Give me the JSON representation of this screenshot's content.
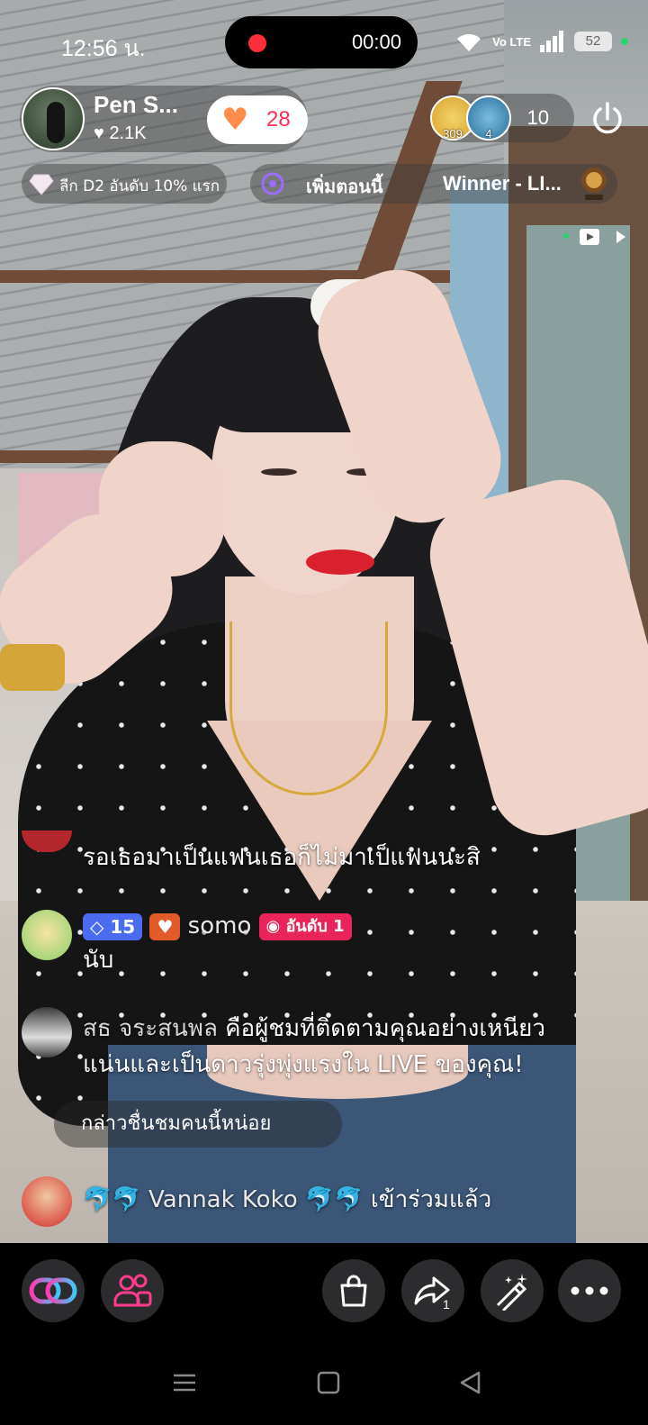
{
  "status_bar": {
    "time": "12:56 น.",
    "recording_time": "00:00",
    "network_label": "Vo LTE",
    "battery": "52"
  },
  "host": {
    "name": "Pen S...",
    "likes": "2.1K",
    "follow_count": "28"
  },
  "viewers": {
    "top1_score": "309",
    "top2_score": "4",
    "count": "10"
  },
  "league_pill": "ลีก D2 อันดับ 10% แรก",
  "goal_pill": {
    "action": "เพิ่มตอนนี้",
    "winner": "Winner - LI..."
  },
  "comments": [
    {
      "text": "รอเธอมาเป็นแฟนเธอก็ไม่มาเป็แฟนนะสิ"
    },
    {
      "level": "15",
      "user": "somo",
      "rank": "อันดับ 1",
      "text": "นับ"
    },
    {
      "user": "สธ จระสนพล",
      "text": "คือผู้ชมที่ติดตามคุณอย่างเหนียว",
      "text2": "แน่นและเป็นดาวรุ่งพุ่งแรงใน LIVE ของคุณ!"
    },
    {
      "suggest": "กล่าวชื่นชมคนนี้หน่อย"
    },
    {
      "user": "Vannak Koko",
      "text": "เข้าร่วมแล้ว"
    }
  ],
  "bottom_bar": {
    "share_count": "1"
  },
  "colors": {
    "accent_pink": "#ff2d55",
    "record_red": "#ff2d3a",
    "level_badge": "#4b6cf0",
    "rank_badge": "#e9245a"
  }
}
